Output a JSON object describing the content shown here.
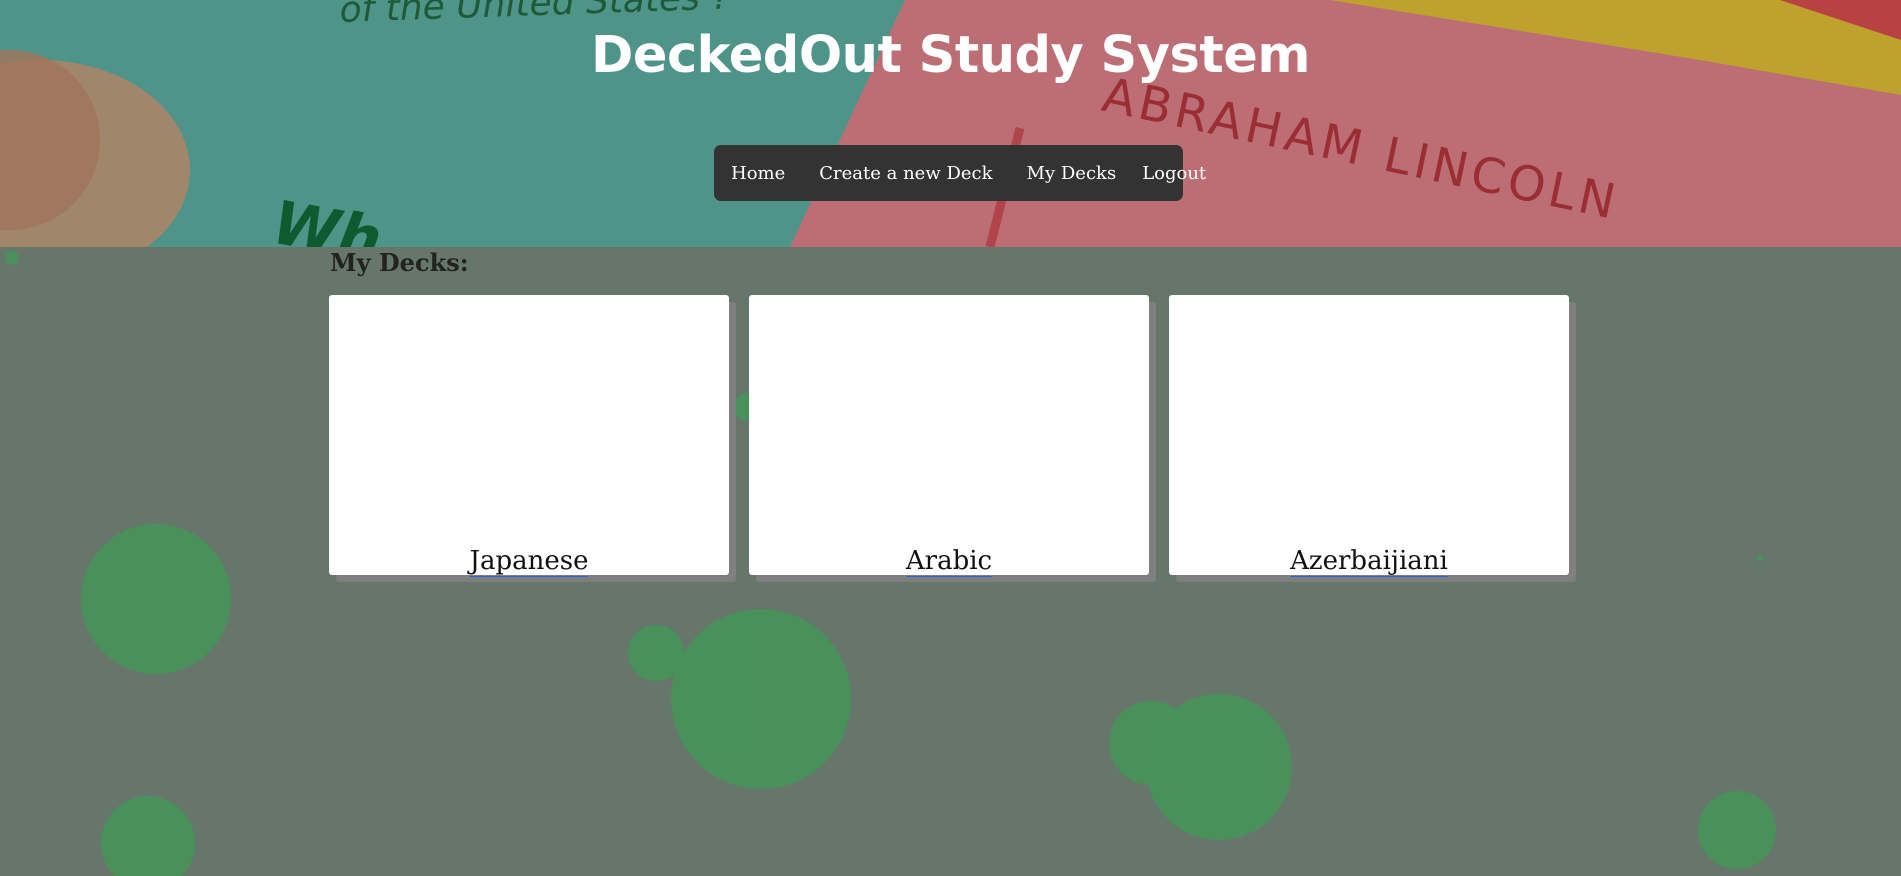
{
  "header": {
    "title": "DeckedOut Study System",
    "background_text": [
      "of the United States ?",
      "ABRAHAM LINCOLN",
      "Wh"
    ]
  },
  "nav": {
    "items": [
      {
        "label": "Home"
      },
      {
        "label": "Create a new Deck"
      },
      {
        "label": "My Decks"
      },
      {
        "label": "Logout"
      }
    ]
  },
  "main": {
    "section_title": "My Decks:",
    "decks": [
      {
        "name": "Japanese"
      },
      {
        "name": "Arabic"
      },
      {
        "name": "Azerbaijiani"
      }
    ]
  },
  "colors": {
    "page_background": "#67766a",
    "navbar": "#333333",
    "bubble": "#3f9a55",
    "card": "#ffffff",
    "card_shadow": "#7f7f7f"
  }
}
